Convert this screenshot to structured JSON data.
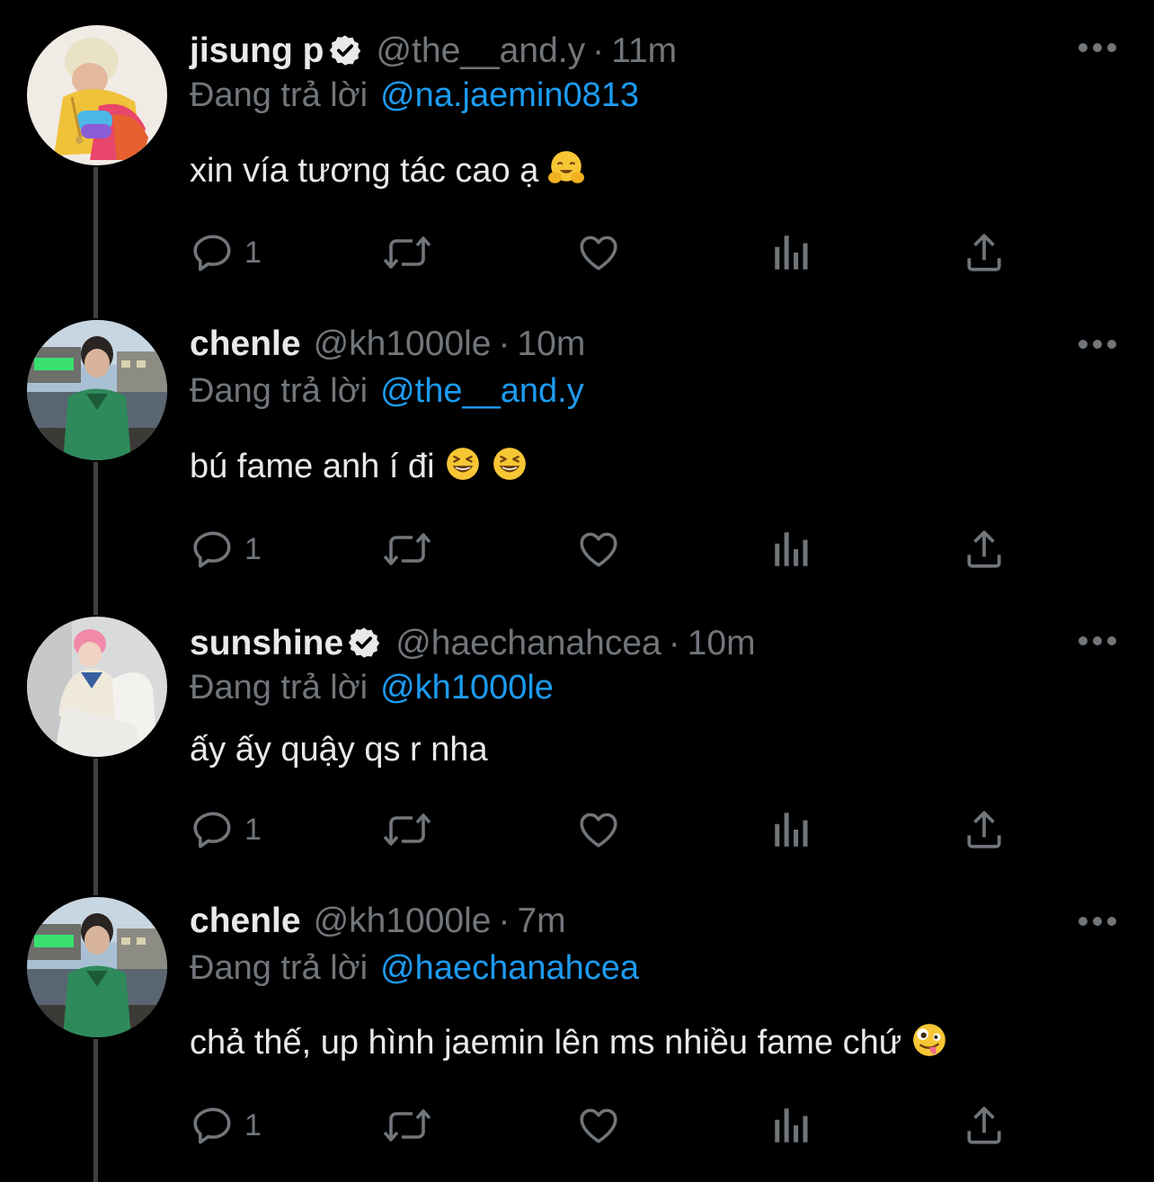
{
  "reply_prefix": "Đang trả lời",
  "colors": {
    "background": "#000000",
    "text_primary": "#e7e9ea",
    "text_secondary": "#71767b",
    "mention": "#1d9bf0",
    "thread_line": "#3e4144"
  },
  "tweets": [
    {
      "name": "jisung p",
      "verified": true,
      "handle": "@the__and.y",
      "separator": "·",
      "time": "11m",
      "replying_to": "@na.jaemin0813",
      "text": "xin vía tương tác cao ạ",
      "emojis": [
        "hugging-face-emoji"
      ],
      "reply_count": "1",
      "avatar": "avatar-jisung"
    },
    {
      "name": "chenle",
      "verified": false,
      "handle": "@kh1000le",
      "separator": "·",
      "time": "10m",
      "replying_to": "@the__and.y",
      "text": "bú fame anh í đi",
      "emojis": [
        "grinning-squinting-face-emoji",
        "grinning-squinting-face-emoji"
      ],
      "reply_count": "1",
      "avatar": "avatar-chenle"
    },
    {
      "name": "sunshine",
      "verified": true,
      "handle": "@haechanahcea",
      "separator": "·",
      "time": "10m",
      "replying_to": "@kh1000le",
      "text": "ấy ấy quậy qs r nha",
      "emojis": [],
      "reply_count": "1",
      "avatar": "avatar-sunshine"
    },
    {
      "name": "chenle",
      "verified": false,
      "handle": "@kh1000le",
      "separator": "·",
      "time": "7m",
      "replying_to": "@haechanahcea",
      "text": "chả thế, up hình jaemin lên ms nhiều fame chứ",
      "emojis": [
        "zany-face-emoji"
      ],
      "reply_count": "1",
      "avatar": "avatar-chenle"
    }
  ]
}
